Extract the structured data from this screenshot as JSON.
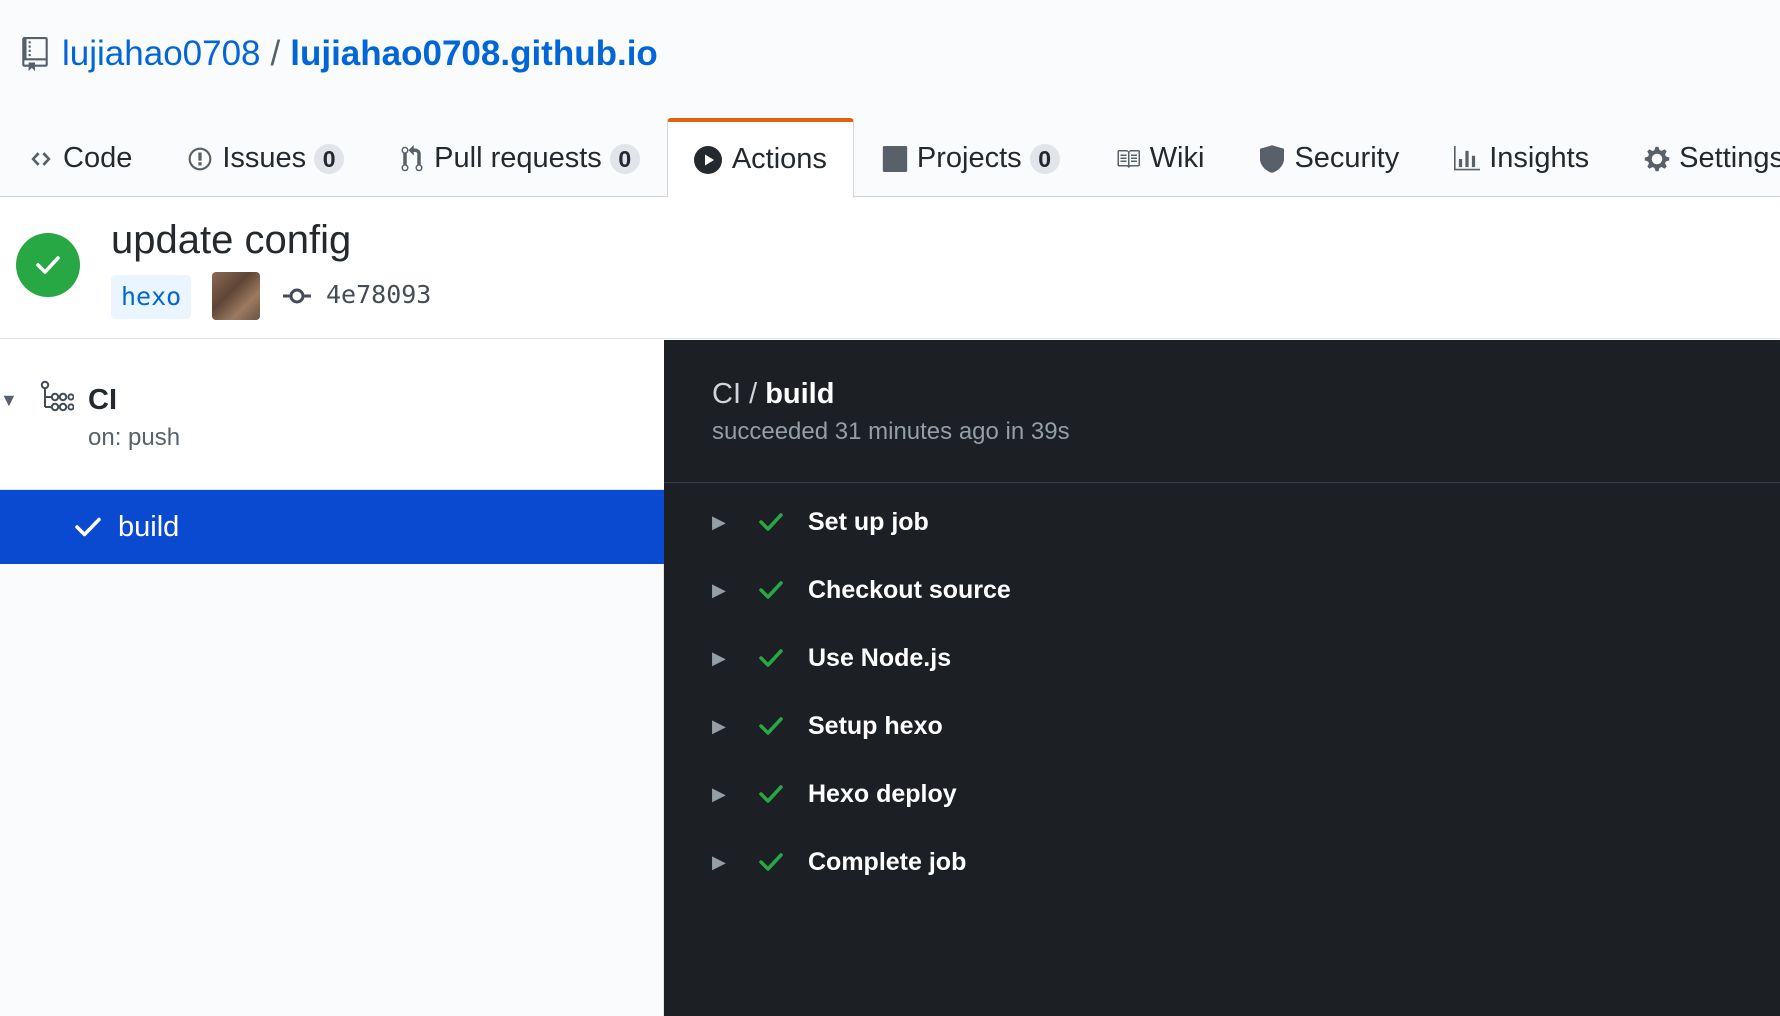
{
  "repo": {
    "owner": "lujiahao0708",
    "separator": "/",
    "name": "lujiahao0708.github.io"
  },
  "tabs": [
    {
      "label": "Code",
      "icon": "code-icon"
    },
    {
      "label": "Issues",
      "icon": "issue-icon",
      "count": "0"
    },
    {
      "label": "Pull requests",
      "icon": "pull-request-icon",
      "count": "0"
    },
    {
      "label": "Actions",
      "icon": "play-icon",
      "selected": true
    },
    {
      "label": "Projects",
      "icon": "project-icon",
      "count": "0"
    },
    {
      "label": "Wiki",
      "icon": "book-icon"
    },
    {
      "label": "Security",
      "icon": "shield-icon"
    },
    {
      "label": "Insights",
      "icon": "graph-icon"
    },
    {
      "label": "Settings",
      "icon": "gear-icon"
    }
  ],
  "run": {
    "title": "update config",
    "branch": "hexo",
    "commit_sha": "4e78093",
    "status": "success"
  },
  "workflow": {
    "name": "CI",
    "trigger": "on: push",
    "jobs": [
      {
        "label": "build",
        "status": "success",
        "selected": true
      }
    ]
  },
  "log": {
    "workflow": "CI",
    "separator": "/",
    "job": "build",
    "summary": "succeeded 31 minutes ago in 39s",
    "steps": [
      {
        "label": "Set up job"
      },
      {
        "label": "Checkout source"
      },
      {
        "label": "Use Node.js"
      },
      {
        "label": "Setup hexo"
      },
      {
        "label": "Hexo deploy"
      },
      {
        "label": "Complete job"
      }
    ]
  },
  "colors": {
    "link": "#0366d6",
    "success": "#28a745",
    "active_tab_accent": "#e36209",
    "selected_job_bg": "#0a4ad1",
    "log_bg": "#1c1f24"
  }
}
